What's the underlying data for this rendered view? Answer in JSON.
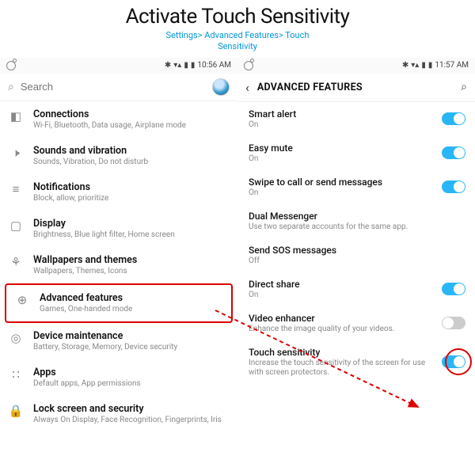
{
  "title": "Activate Touch Sensitivity",
  "subtitle": "Settings> Advanced Features> Touch\nSensitivity",
  "left": {
    "status_time": "10:56 AM",
    "search_placeholder": "Search",
    "items": [
      {
        "label": "Connections",
        "sub": "Wi-Fi, Bluetooth, Data usage, Airplane mode"
      },
      {
        "label": "Sounds and vibration",
        "sub": "Sounds, Vibration, Do not disturb"
      },
      {
        "label": "Notifications",
        "sub": "Block, allow, prioritize"
      },
      {
        "label": "Display",
        "sub": "Brightness, Blue light filter, Home screen"
      },
      {
        "label": "Wallpapers and themes",
        "sub": "Wallpapers, Themes, Icons"
      },
      {
        "label": "Advanced features",
        "sub": "Games, One-handed mode"
      },
      {
        "label": "Device maintenance",
        "sub": "Battery, Storage, Memory, Device security"
      },
      {
        "label": "Apps",
        "sub": "Default apps, App permissions"
      },
      {
        "label": "Lock screen and security",
        "sub": "Always On Display, Face Recognition, Fingerprints, Iris"
      }
    ]
  },
  "right": {
    "status_time": "11:57 AM",
    "header": "ADVANCED FEATURES",
    "items": [
      {
        "label": "Smart alert",
        "sub": "On",
        "toggle": "on"
      },
      {
        "label": "Easy mute",
        "sub": "On",
        "toggle": "on"
      },
      {
        "label": "Swipe to call or send messages",
        "sub": "On",
        "toggle": "on"
      },
      {
        "label": "Dual Messenger",
        "sub": "Use two separate accounts for the same app.",
        "toggle": null
      },
      {
        "label": "Send SOS messages",
        "sub": "Off",
        "toggle": null
      },
      {
        "label": "Direct share",
        "sub": "On",
        "toggle": "on"
      },
      {
        "label": "Video enhancer",
        "sub": "Enhance the image quality of your videos.",
        "toggle": "off"
      },
      {
        "label": "Touch sensitivity",
        "sub": "Increase the touch sensitivity of the screen for use with screen protectors.",
        "toggle": "on"
      }
    ]
  }
}
